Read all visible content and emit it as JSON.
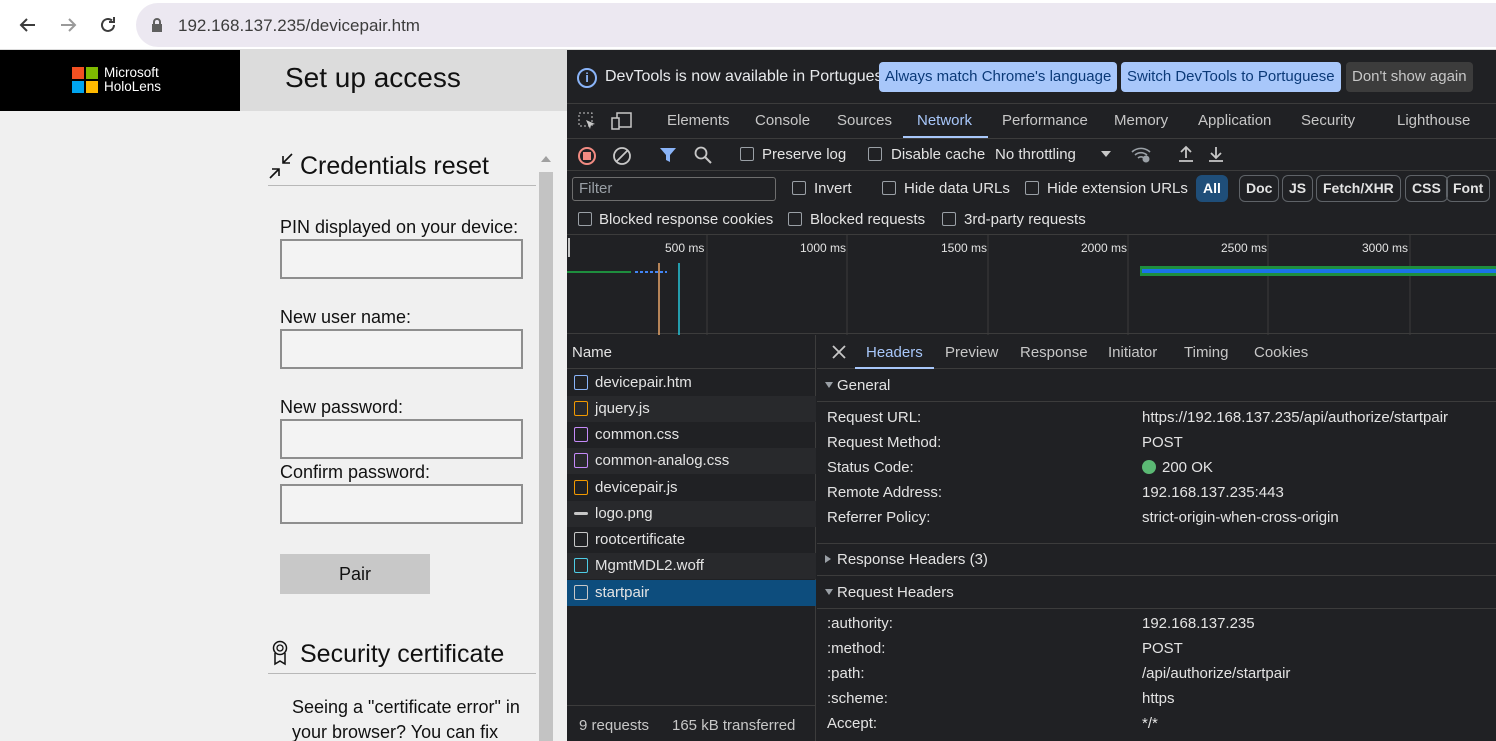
{
  "browser": {
    "url": "192.168.137.235/devicepair.htm"
  },
  "page": {
    "logo_line1": "Microsoft",
    "logo_line2": "HoloLens",
    "title": "Set up access",
    "credentials_heading": "Credentials reset",
    "pin_label": "PIN displayed on your device:",
    "username_label": "New user name:",
    "password_label": "New password:",
    "confirm_label": "Confirm password:",
    "pair_button": "Pair",
    "cert_heading": "Security certificate",
    "cert_text": "Seeing a \"certificate error\" in your browser? You can fix"
  },
  "devtools": {
    "info_message": "DevTools is now available in Portuguese!",
    "info_btn1": "Always match Chrome's language",
    "info_btn2": "Switch DevTools to Portuguese",
    "info_btn3": "Don't show again",
    "tabs": [
      "Elements",
      "Console",
      "Sources",
      "Network",
      "Performance",
      "Memory",
      "Application",
      "Security",
      "Lighthouse"
    ],
    "active_tab": "Network",
    "preserve_log": "Preserve log",
    "disable_cache": "Disable cache",
    "throttling": "No throttling",
    "filter_placeholder": "Filter",
    "invert": "Invert",
    "hide_data_urls": "Hide data URLs",
    "hide_ext_urls": "Hide extension URLs",
    "chips": [
      "All",
      "Doc",
      "JS",
      "Fetch/XHR",
      "CSS",
      "Font"
    ],
    "blocked_cookies": "Blocked response cookies",
    "blocked_requests": "Blocked requests",
    "third_party": "3rd-party requests",
    "timeline_ticks": [
      "500 ms",
      "1000 ms",
      "1500 ms",
      "2000 ms",
      "2500 ms",
      "3000 ms"
    ],
    "name_header": "Name",
    "requests": [
      {
        "name": "devicepair.htm",
        "type": "doc"
      },
      {
        "name": "jquery.js",
        "type": "js"
      },
      {
        "name": "common.css",
        "type": "css"
      },
      {
        "name": "common-analog.css",
        "type": "css"
      },
      {
        "name": "devicepair.js",
        "type": "js"
      },
      {
        "name": "logo.png",
        "type": "img"
      },
      {
        "name": "rootcertificate",
        "type": "other"
      },
      {
        "name": "MgmtMDL2.woff",
        "type": "font"
      },
      {
        "name": "startpair",
        "type": "other"
      }
    ],
    "request_count": "9 requests",
    "transferred": "165 kB transferred",
    "detail_tabs": [
      "Headers",
      "Preview",
      "Response",
      "Initiator",
      "Timing",
      "Cookies"
    ],
    "general_title": "General",
    "general": [
      {
        "k": "Request URL:",
        "v": "https://192.168.137.235/api/authorize/startpair"
      },
      {
        "k": "Request Method:",
        "v": "POST"
      },
      {
        "k": "Status Code:",
        "v": "200 OK"
      },
      {
        "k": "Remote Address:",
        "v": "192.168.137.235:443"
      },
      {
        "k": "Referrer Policy:",
        "v": "strict-origin-when-cross-origin"
      }
    ],
    "response_headers_title": "Response Headers (3)",
    "request_headers_title": "Request Headers",
    "request_headers": [
      {
        "k": ":authority:",
        "v": "192.168.137.235"
      },
      {
        "k": ":method:",
        "v": "POST"
      },
      {
        "k": ":path:",
        "v": "/api/authorize/startpair"
      },
      {
        "k": ":scheme:",
        "v": "https"
      },
      {
        "k": "Accept:",
        "v": "*/*"
      }
    ],
    "colors": {
      "accent": "#a8c7fa",
      "selected_row": "#0d4d7d",
      "status_ok": "#5bb974"
    }
  }
}
